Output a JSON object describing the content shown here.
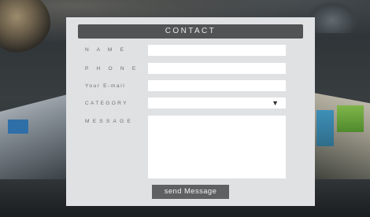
{
  "form": {
    "title": "CONTACT",
    "fields": {
      "name_label": "N A M E",
      "phone_label": "P H O N E",
      "email_label": "Your E-mail",
      "category_label": "CATEGORY",
      "message_label": "MESSAGE",
      "name_value": "",
      "phone_value": "",
      "email_value": "",
      "category_value": "",
      "message_value": ""
    },
    "category_arrow": "▼",
    "submit_label": "send Message"
  },
  "icons": {
    "category_dropdown": "chevron-down-icon"
  },
  "colors": {
    "panel_bg": "#dfe1e3",
    "header_bg": "#525354",
    "button_bg": "#5f6062",
    "label_text": "#6e6f70"
  }
}
